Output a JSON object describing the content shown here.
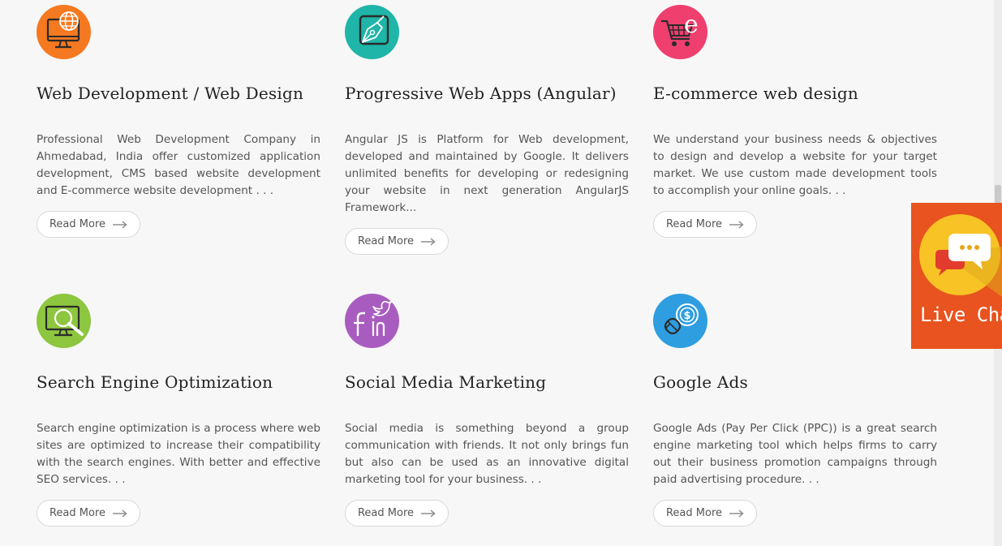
{
  "services": [
    {
      "title": "Web Development / Web Design",
      "description": "Professional Web Development Company in Ahmedabad, India offer customized application development, CMS based website development and E-commerce website development . . .",
      "button_label": "Read More",
      "icon": "monitor-globe-icon",
      "color": "#f47920"
    },
    {
      "title": "Progressive Web Apps (Angular)",
      "description": "Angular JS is Platform for Web development, developed and maintained by Google. It delivers unlimited benefits for developing or redesigning your website in next generation AngularJS Framework...",
      "button_label": "Read More",
      "icon": "pen-tool-icon",
      "color": "#1fb5a8"
    },
    {
      "title": "E-commerce web design",
      "description": "We understand your business needs & objectives to design and develop a website for your target market. We use custom made development tools to accomplish your online goals. . .",
      "button_label": "Read More",
      "icon": "shopping-cart-icon",
      "color": "#ef3f6f"
    },
    {
      "title": "Search Engine Optimization",
      "description": "Search engine optimization is a process where web sites are optimized to increase their compatibility with the search engines. With better and effective SEO services. . .",
      "button_label": "Read More",
      "icon": "monitor-search-icon",
      "color": "#8dc63f"
    },
    {
      "title": "Social Media Marketing",
      "description": "Social media is something beyond a group communication with friends. It not only brings fun but also can be used as an innovative digital marketing tool for your business. . .",
      "button_label": "Read More",
      "icon": "social-media-icon",
      "color": "#a95cbf"
    },
    {
      "title": "Google Ads",
      "description": "Google Ads (Pay Per Click (PPC)) is a great search engine marketing tool which helps firms to carry out their business promotion campaigns through paid advertising procedure. . .",
      "button_label": "Read More",
      "icon": "mouse-dollar-icon",
      "color": "#2e9ee0"
    }
  ],
  "live_chat": {
    "label": "Live Chat",
    "icon": "chat-bubbles-icon",
    "background": "#e8531f"
  }
}
